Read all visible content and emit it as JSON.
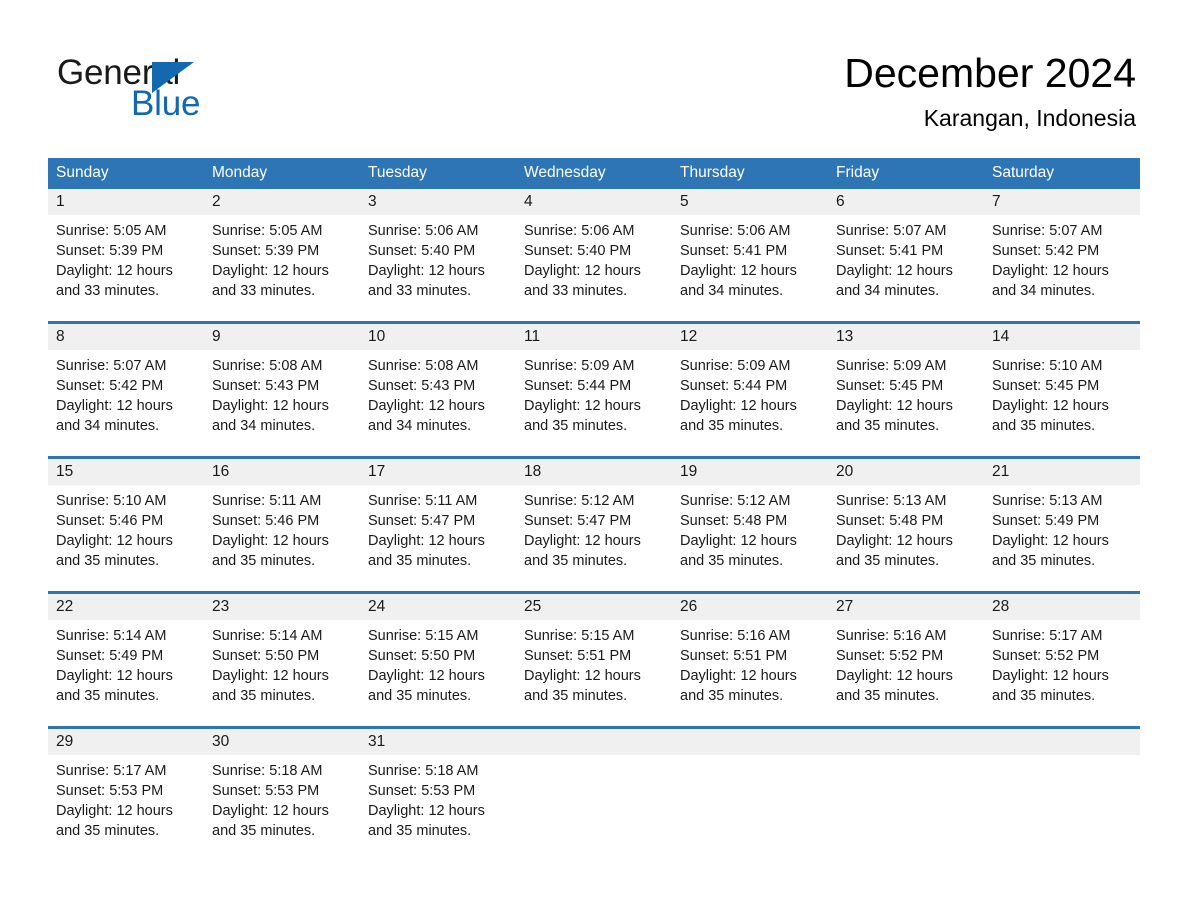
{
  "logo": {
    "word_one": "General",
    "word_two": "Blue",
    "triangle_color": "#1269b0"
  },
  "header": {
    "month_title": "December 2024",
    "location": "Karangan, Indonesia"
  },
  "theme": {
    "header_blue": "#2e75b6",
    "row_divider_blue": "#2e75b6",
    "daynum_band": "#f0f0f0",
    "text": "#1a1a1a"
  },
  "calendar": {
    "weekday_headers": [
      "Sunday",
      "Monday",
      "Tuesday",
      "Wednesday",
      "Thursday",
      "Friday",
      "Saturday"
    ],
    "weeks": [
      [
        {
          "day": "1",
          "sunrise": "Sunrise: 5:05 AM",
          "sunset": "Sunset: 5:39 PM",
          "daylight": "Daylight: 12 hours and 33 minutes."
        },
        {
          "day": "2",
          "sunrise": "Sunrise: 5:05 AM",
          "sunset": "Sunset: 5:39 PM",
          "daylight": "Daylight: 12 hours and 33 minutes."
        },
        {
          "day": "3",
          "sunrise": "Sunrise: 5:06 AM",
          "sunset": "Sunset: 5:40 PM",
          "daylight": "Daylight: 12 hours and 33 minutes."
        },
        {
          "day": "4",
          "sunrise": "Sunrise: 5:06 AM",
          "sunset": "Sunset: 5:40 PM",
          "daylight": "Daylight: 12 hours and 33 minutes."
        },
        {
          "day": "5",
          "sunrise": "Sunrise: 5:06 AM",
          "sunset": "Sunset: 5:41 PM",
          "daylight": "Daylight: 12 hours and 34 minutes."
        },
        {
          "day": "6",
          "sunrise": "Sunrise: 5:07 AM",
          "sunset": "Sunset: 5:41 PM",
          "daylight": "Daylight: 12 hours and 34 minutes."
        },
        {
          "day": "7",
          "sunrise": "Sunrise: 5:07 AM",
          "sunset": "Sunset: 5:42 PM",
          "daylight": "Daylight: 12 hours and 34 minutes."
        }
      ],
      [
        {
          "day": "8",
          "sunrise": "Sunrise: 5:07 AM",
          "sunset": "Sunset: 5:42 PM",
          "daylight": "Daylight: 12 hours and 34 minutes."
        },
        {
          "day": "9",
          "sunrise": "Sunrise: 5:08 AM",
          "sunset": "Sunset: 5:43 PM",
          "daylight": "Daylight: 12 hours and 34 minutes."
        },
        {
          "day": "10",
          "sunrise": "Sunrise: 5:08 AM",
          "sunset": "Sunset: 5:43 PM",
          "daylight": "Daylight: 12 hours and 34 minutes."
        },
        {
          "day": "11",
          "sunrise": "Sunrise: 5:09 AM",
          "sunset": "Sunset: 5:44 PM",
          "daylight": "Daylight: 12 hours and 35 minutes."
        },
        {
          "day": "12",
          "sunrise": "Sunrise: 5:09 AM",
          "sunset": "Sunset: 5:44 PM",
          "daylight": "Daylight: 12 hours and 35 minutes."
        },
        {
          "day": "13",
          "sunrise": "Sunrise: 5:09 AM",
          "sunset": "Sunset: 5:45 PM",
          "daylight": "Daylight: 12 hours and 35 minutes."
        },
        {
          "day": "14",
          "sunrise": "Sunrise: 5:10 AM",
          "sunset": "Sunset: 5:45 PM",
          "daylight": "Daylight: 12 hours and 35 minutes."
        }
      ],
      [
        {
          "day": "15",
          "sunrise": "Sunrise: 5:10 AM",
          "sunset": "Sunset: 5:46 PM",
          "daylight": "Daylight: 12 hours and 35 minutes."
        },
        {
          "day": "16",
          "sunrise": "Sunrise: 5:11 AM",
          "sunset": "Sunset: 5:46 PM",
          "daylight": "Daylight: 12 hours and 35 minutes."
        },
        {
          "day": "17",
          "sunrise": "Sunrise: 5:11 AM",
          "sunset": "Sunset: 5:47 PM",
          "daylight": "Daylight: 12 hours and 35 minutes."
        },
        {
          "day": "18",
          "sunrise": "Sunrise: 5:12 AM",
          "sunset": "Sunset: 5:47 PM",
          "daylight": "Daylight: 12 hours and 35 minutes."
        },
        {
          "day": "19",
          "sunrise": "Sunrise: 5:12 AM",
          "sunset": "Sunset: 5:48 PM",
          "daylight": "Daylight: 12 hours and 35 minutes."
        },
        {
          "day": "20",
          "sunrise": "Sunrise: 5:13 AM",
          "sunset": "Sunset: 5:48 PM",
          "daylight": "Daylight: 12 hours and 35 minutes."
        },
        {
          "day": "21",
          "sunrise": "Sunrise: 5:13 AM",
          "sunset": "Sunset: 5:49 PM",
          "daylight": "Daylight: 12 hours and 35 minutes."
        }
      ],
      [
        {
          "day": "22",
          "sunrise": "Sunrise: 5:14 AM",
          "sunset": "Sunset: 5:49 PM",
          "daylight": "Daylight: 12 hours and 35 minutes."
        },
        {
          "day": "23",
          "sunrise": "Sunrise: 5:14 AM",
          "sunset": "Sunset: 5:50 PM",
          "daylight": "Daylight: 12 hours and 35 minutes."
        },
        {
          "day": "24",
          "sunrise": "Sunrise: 5:15 AM",
          "sunset": "Sunset: 5:50 PM",
          "daylight": "Daylight: 12 hours and 35 minutes."
        },
        {
          "day": "25",
          "sunrise": "Sunrise: 5:15 AM",
          "sunset": "Sunset: 5:51 PM",
          "daylight": "Daylight: 12 hours and 35 minutes."
        },
        {
          "day": "26",
          "sunrise": "Sunrise: 5:16 AM",
          "sunset": "Sunset: 5:51 PM",
          "daylight": "Daylight: 12 hours and 35 minutes."
        },
        {
          "day": "27",
          "sunrise": "Sunrise: 5:16 AM",
          "sunset": "Sunset: 5:52 PM",
          "daylight": "Daylight: 12 hours and 35 minutes."
        },
        {
          "day": "28",
          "sunrise": "Sunrise: 5:17 AM",
          "sunset": "Sunset: 5:52 PM",
          "daylight": "Daylight: 12 hours and 35 minutes."
        }
      ],
      [
        {
          "day": "29",
          "sunrise": "Sunrise: 5:17 AM",
          "sunset": "Sunset: 5:53 PM",
          "daylight": "Daylight: 12 hours and 35 minutes."
        },
        {
          "day": "30",
          "sunrise": "Sunrise: 5:18 AM",
          "sunset": "Sunset: 5:53 PM",
          "daylight": "Daylight: 12 hours and 35 minutes."
        },
        {
          "day": "31",
          "sunrise": "Sunrise: 5:18 AM",
          "sunset": "Sunset: 5:53 PM",
          "daylight": "Daylight: 12 hours and 35 minutes."
        },
        {
          "day": "",
          "sunrise": "",
          "sunset": "",
          "daylight": ""
        },
        {
          "day": "",
          "sunrise": "",
          "sunset": "",
          "daylight": ""
        },
        {
          "day": "",
          "sunrise": "",
          "sunset": "",
          "daylight": ""
        },
        {
          "day": "",
          "sunrise": "",
          "sunset": "",
          "daylight": ""
        }
      ]
    ]
  }
}
